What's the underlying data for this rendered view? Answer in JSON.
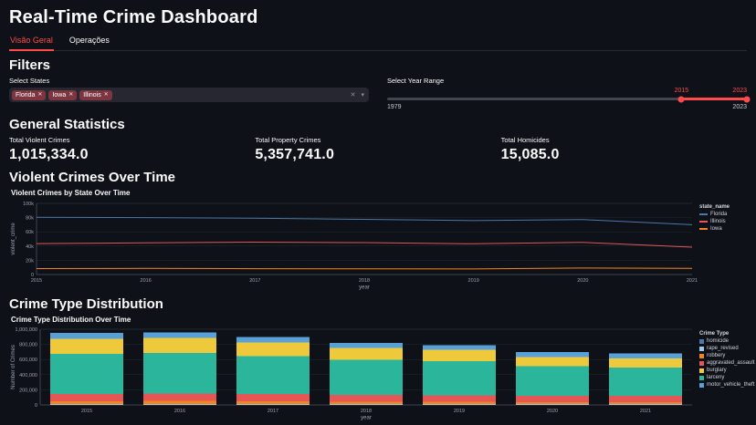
{
  "app": {
    "title": "Real-Time Crime Dashboard"
  },
  "tabs": [
    {
      "label": "Visão Geral",
      "active": true
    },
    {
      "label": "Operações",
      "active": false
    }
  ],
  "filters": {
    "heading": "Filters",
    "states": {
      "label": "Select States",
      "selected": [
        "Florida",
        "Iowa",
        "Illinois"
      ]
    },
    "year_range": {
      "label": "Select Year Range",
      "min": 1979,
      "max": 2023,
      "selected_start": 2015,
      "selected_end": 2023
    }
  },
  "stats": {
    "heading": "General Statistics",
    "metrics": [
      {
        "label": "Total Violent Crimes",
        "value": "1,015,334.0"
      },
      {
        "label": "Total Property Crimes",
        "value": "5,357,741.0"
      },
      {
        "label": "Total Homicides",
        "value": "15,085.0"
      }
    ]
  },
  "sections": {
    "violent": "Violent Crimes Over Time",
    "distribution": "Crime Type Distribution"
  },
  "icons": {
    "clear": "✕",
    "caret": "▾",
    "remove": "✕"
  },
  "colors": {
    "accent": "#ff4b4b",
    "background": "#0e1117",
    "input_background": "#262730",
    "tag_background": "#7d3540"
  },
  "chart_data": [
    {
      "type": "line",
      "title": "Violent Crimes by State Over Time",
      "xlabel": "year",
      "ylabel": "violent_crime",
      "legend_title": "state_name",
      "legend_position": "right",
      "grid": true,
      "x": [
        2015,
        2016,
        2017,
        2018,
        2019,
        2020,
        2021
      ],
      "ylim": [
        0,
        100000
      ],
      "yticks": [
        {
          "v": 0,
          "label": "0"
        },
        {
          "v": 20000,
          "label": "20k"
        },
        {
          "v": 40000,
          "label": "40k"
        },
        {
          "v": 60000,
          "label": "60k"
        },
        {
          "v": 80000,
          "label": "80k"
        },
        {
          "v": 100000,
          "label": "100k"
        }
      ],
      "series": [
        {
          "name": "Florida",
          "color": "#4c78a8",
          "values": [
            80500,
            80000,
            79200,
            77500,
            75800,
            77300,
            70000
          ]
        },
        {
          "name": "Illinois",
          "color": "#e45756",
          "values": [
            43500,
            44500,
            45500,
            44800,
            43200,
            45200,
            38500
          ]
        },
        {
          "name": "Iowa",
          "color": "#f58518",
          "values": [
            8300,
            8600,
            8200,
            8000,
            7800,
            9200,
            8600
          ]
        }
      ],
      "legend": [
        "Florida",
        "Illinois",
        "Iowa"
      ]
    },
    {
      "type": "bar",
      "stacked": true,
      "title": "Crime Type Distribution Over Time",
      "xlabel": "year",
      "ylabel": "Number of Crimes",
      "legend_title": "Crime Type",
      "legend_position": "right",
      "grid": true,
      "categories": [
        2015,
        2016,
        2017,
        2018,
        2019,
        2020,
        2021
      ],
      "ylim": [
        0,
        1000000
      ],
      "yticks": [
        {
          "v": 0,
          "label": "0"
        },
        {
          "v": 200000,
          "label": "200,000"
        },
        {
          "v": 400000,
          "label": "400,000"
        },
        {
          "v": 600000,
          "label": "600,000"
        },
        {
          "v": 800000,
          "label": "800,000"
        },
        {
          "v": 1000000,
          "label": "1,000,000"
        }
      ],
      "series": [
        {
          "name": "homicide",
          "color": "#4c78a8",
          "values": [
            2000,
            2100,
            2100,
            2000,
            2000,
            2400,
            2500
          ]
        },
        {
          "name": "rape_revised",
          "color": "#9ecae9",
          "values": [
            11000,
            11500,
            11000,
            10500,
            10000,
            9000,
            9000
          ]
        },
        {
          "name": "robbery",
          "color": "#f58518",
          "values": [
            38000,
            39000,
            36000,
            32000,
            30000,
            26000,
            24000
          ]
        },
        {
          "name": "aggravated_assault",
          "color": "#e45756",
          "values": [
            95000,
            97000,
            93000,
            88000,
            86000,
            85000,
            86000
          ]
        },
        {
          "name": "larceny",
          "color": "#2bb59a",
          "values": [
            530000,
            535000,
            505000,
            465000,
            452000,
            390000,
            375000
          ]
        },
        {
          "name": "burglary",
          "color": "#eec93c",
          "values": [
            200000,
            198000,
            180000,
            157000,
            146000,
            123000,
            118000
          ]
        },
        {
          "name": "motor_vehicle_theft",
          "color": "#58a0d8",
          "values": [
            74000,
            77400,
            72900,
            65500,
            64000,
            64600,
            65500
          ]
        }
      ],
      "legend": [
        "homicide",
        "rape_revised",
        "robbery",
        "aggravated_assault",
        "burglary",
        "larceny",
        "motor_vehicle_theft"
      ]
    }
  ]
}
